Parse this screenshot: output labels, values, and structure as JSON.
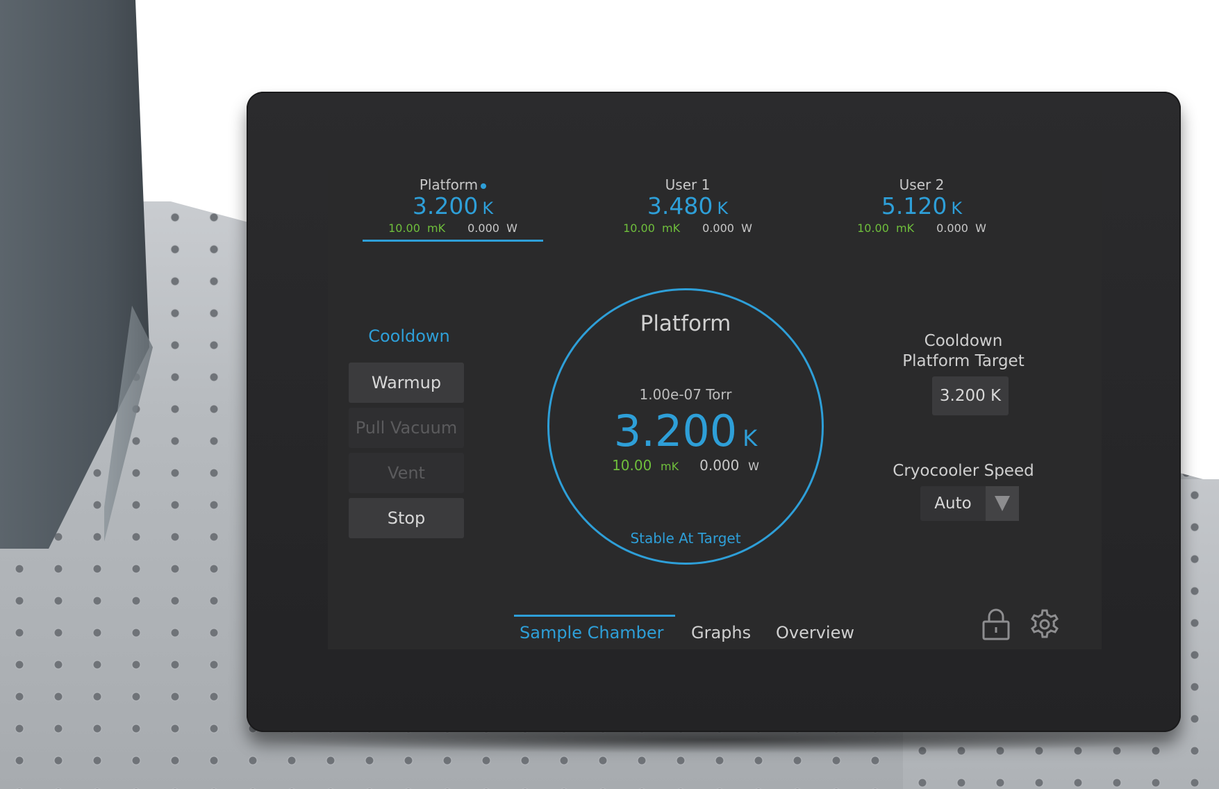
{
  "sensors": [
    {
      "name": "Platform",
      "temperature": "3.200",
      "unit": "K",
      "stability": "10.00",
      "stability_unit": "mK",
      "power": "0.000",
      "power_unit": "W",
      "active": true
    },
    {
      "name": "User 1",
      "temperature": "3.480",
      "unit": "K",
      "stability": "10.00",
      "stability_unit": "mK",
      "power": "0.000",
      "power_unit": "W",
      "active": false
    },
    {
      "name": "User 2",
      "temperature": "5.120",
      "unit": "K",
      "stability": "10.00",
      "stability_unit": "mK",
      "power": "0.000",
      "power_unit": "W",
      "active": false
    }
  ],
  "controls": {
    "mode": "Cooldown",
    "buttons": [
      {
        "label": "Warmup",
        "enabled": true
      },
      {
        "label": "Pull Vacuum",
        "enabled": false
      },
      {
        "label": "Vent",
        "enabled": false
      },
      {
        "label": "Stop",
        "enabled": true
      }
    ]
  },
  "gauge": {
    "title": "Platform",
    "pressure": "1.00e-07 Torr",
    "temperature": "3.200",
    "unit": "K",
    "stability": "10.00",
    "stability_unit": "mK",
    "power": "0.000",
    "power_unit": "W",
    "status": "Stable At Target"
  },
  "target": {
    "label_line1": "Cooldown",
    "label_line2": "Platform Target",
    "value": "3.200 K"
  },
  "cryocooler": {
    "label": "Cryocooler Speed",
    "selected": "Auto"
  },
  "tabs": [
    {
      "label": "Sample Chamber",
      "active": true
    },
    {
      "label": "Graphs",
      "active": false
    },
    {
      "label": "Overview",
      "active": false
    }
  ],
  "icons": {
    "lock": "lock-icon",
    "settings": "gear-icon"
  },
  "colors": {
    "accent": "#2e9fd8",
    "green": "#6fbf3c",
    "screen": "#2a2a2b"
  }
}
